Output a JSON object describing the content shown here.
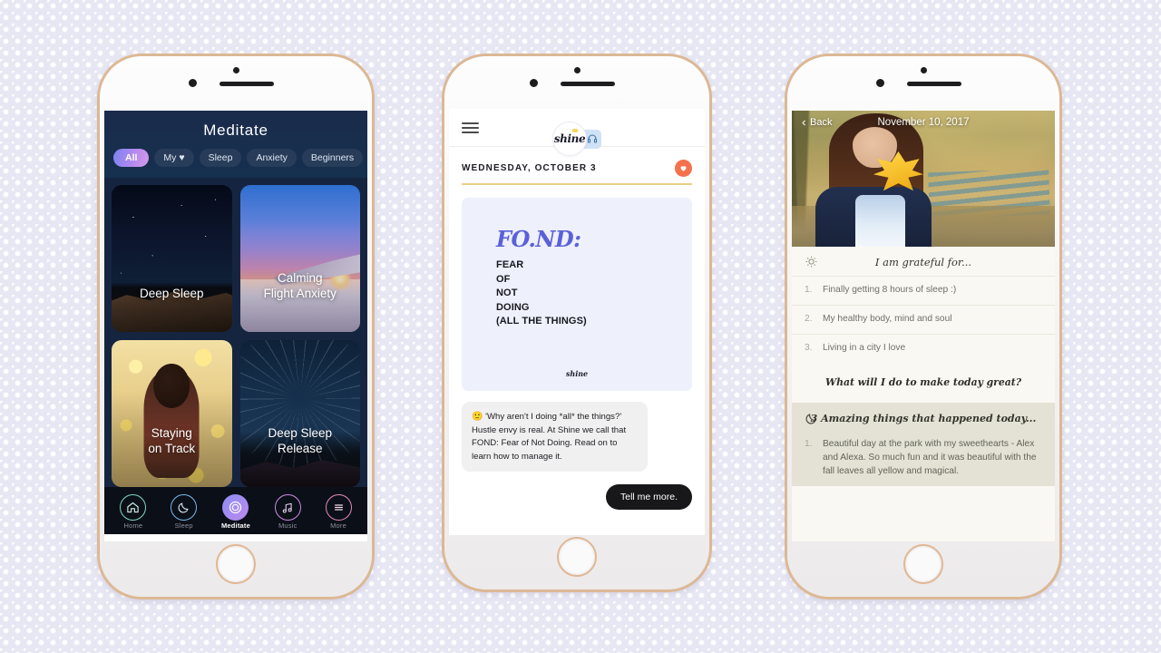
{
  "background": {
    "color": "#e7e7f4",
    "pattern": "diamond-grid"
  },
  "phone1": {
    "app": "Shine Meditate",
    "header_title": "Meditate",
    "filters": [
      {
        "label": "All",
        "active": true
      },
      {
        "label": "My ♥",
        "active": false
      },
      {
        "label": "Sleep",
        "active": false
      },
      {
        "label": "Anxiety",
        "active": false
      },
      {
        "label": "Beginners",
        "active": false
      }
    ],
    "cards": [
      {
        "title": "Deep Sleep",
        "art": "night-sky-cliff"
      },
      {
        "title": "Calming\nFlight Anxiety",
        "line1": "Calming",
        "line2": "Flight Anxiety",
        "art": "airplane-wing-sunset"
      },
      {
        "title": "Staying\non Track",
        "line1": "Staying",
        "line2": "on Track",
        "art": "woman-autumn-flowers"
      },
      {
        "title": "Deep Sleep\nRelease",
        "line1": "Deep Sleep",
        "line2": "Release",
        "art": "star-trails"
      }
    ],
    "tabs": [
      {
        "label": "Home",
        "icon": "home-icon",
        "active": false
      },
      {
        "label": "Sleep",
        "icon": "moon-icon",
        "active": false
      },
      {
        "label": "Meditate",
        "icon": "circles-icon",
        "active": true
      },
      {
        "label": "Music",
        "icon": "music-note-icon",
        "active": false
      },
      {
        "label": "More",
        "icon": "hamburger-icon",
        "active": false
      }
    ],
    "accent_active": "#b98bee"
  },
  "phone2": {
    "app": "Shine Daily",
    "menu_icon": "hamburger-icon",
    "logo_text": "shine",
    "headphone_icon": "headphone-icon",
    "date": "WEDNESDAY, OCTOBER 3",
    "favorite_icon": "heart-icon",
    "favorite_color": "#f4714b",
    "rule_color": "#e8cf82",
    "card": {
      "title": "FO.ND:",
      "lines": [
        "FEAR",
        "OF",
        "NOT",
        "DOING",
        "(ALL THE THINGS)"
      ],
      "watermark": "shine",
      "background": "#eef0fb",
      "title_color": "#5a61d8"
    },
    "message": {
      "emoji": "🙂",
      "text": "'Why aren't I doing *all* the things?' Hustle envy is real. At Shine we call that FOND: Fear of Not Doing. Read on to learn how to manage it."
    },
    "cta_label": "Tell me more."
  },
  "phone3": {
    "app": "Shine Journal",
    "back_label": "Back",
    "back_icon": "chevron-left-icon",
    "date": "November 10, 2017",
    "photo_alt": "woman holding yellow maple leaf in autumn park",
    "sections": [
      {
        "icon": "sun-icon",
        "title": "I am grateful for...",
        "items": [
          {
            "num": "1.",
            "text": "Finally getting 8 hours of sleep :)"
          },
          {
            "num": "2.",
            "text": "My healthy body, mind and soul"
          },
          {
            "num": "3.",
            "text": "Living in a city I love"
          }
        ]
      }
    ],
    "prompt": "What will I do to make today great?",
    "evening": {
      "icon": "moon-icon",
      "title": "3 Amazing things that happened today...",
      "items": [
        {
          "num": "1.",
          "text": "Beautiful day at the park with my sweethearts - Alex and Alexa. So much fun and it was beautiful with the fall leaves all yellow and magical."
        }
      ]
    }
  }
}
